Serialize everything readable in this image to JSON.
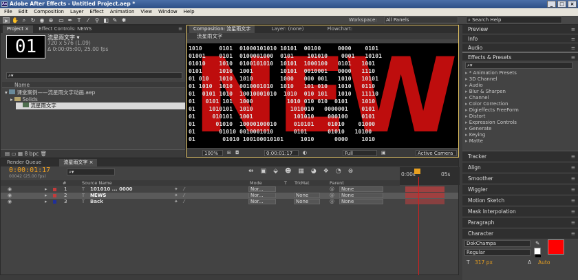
{
  "app": {
    "title": "Adobe After Effects - Untitled Project.aep *",
    "badge": "Ae"
  },
  "window_controls": [
    "_",
    "□",
    "×"
  ],
  "menu": [
    "File",
    "Edit",
    "Composition",
    "Layer",
    "Effect",
    "Animation",
    "View",
    "Window",
    "Help"
  ],
  "toolbar": {
    "workspace_label": "Workspace:",
    "workspace_value": "All Panels",
    "search_help": "Search Help"
  },
  "project_panel": {
    "tabs": [
      "Project ×",
      "Effect Controls: NEWS"
    ],
    "thumb_text": "01",
    "comp_name": "流星雨文字 ▾",
    "comp_dims": "720 x 576 (1.09)",
    "comp_duration": "Δ 0:00:05:00, 25.00 fps",
    "search_placeholder": "⌕▾",
    "column_name": "Name",
    "items": [
      {
        "label": "课堂案例——流星雨文字动画.aep",
        "type": "project"
      },
      {
        "label": "Solids",
        "type": "folder"
      },
      {
        "label": "流星雨文字",
        "type": "comp"
      }
    ],
    "footer_bpc": "8 bpc"
  },
  "comp_panel": {
    "tabs": [
      "Composition: 流星雨文字",
      "Layer: (none)",
      "Flowchart:"
    ],
    "subtab": "流星雨文字",
    "binary_rows": [
      "1010     0101  01000101010 10101  00100     0000    0101",
      "01001    0101  0100001000  0101    101010    0001   10101",
      "01010    1010  0100101010  10101  1000100   0101   1001",
      "0101     1010  1001        10101  0010001   0000   1110",
      "01 010   1010  1010        1000   000 001   1010   10101",
      "01 1010  1010  0010001010  1010   101 010   1010   0110",
      "01  0101 1010  10010001010  1010  010 101   1010   11110",
      "01   0101 101  1000          1010 010 010  0101    1010",
      "01    1010101  1010           1010010   0000001    0101",
      "01     010101  1001            101010    000100    0101",
      "01      01010  10000100010     010101    01010    01000",
      "01       01010 0010001010      0101      01010   10100",
      "01        01010 100100010101     1010      0000    1010"
    ],
    "big_text": "NEWS",
    "zoom": "100%",
    "timecode": "0:00:01:17",
    "resolution": "Full",
    "camera": "Active Camera"
  },
  "timeline": {
    "tabs": [
      "Render Queue",
      "流星雨文字 ×"
    ],
    "current_time": "0:00:01:17",
    "fps_line": "00042 (25.00 fps)",
    "search_placeholder": "⌕▾",
    "columns": {
      "num": "#",
      "source": "Source Name",
      "mode": "Mode",
      "t": "T",
      "trkmat": "TrkMat",
      "parent": "Parent"
    },
    "ruler": {
      "start": "0:00s",
      "end": "05s"
    },
    "layers": [
      {
        "num": "1",
        "name": "101010 ... 0000",
        "mode": "Nor...",
        "trkmat": "",
        "parent": "None",
        "color": "#c33c3c",
        "selected": false
      },
      {
        "num": "2",
        "name": "NEWS",
        "mode": "Nor...",
        "trkmat": "None",
        "parent": "None",
        "color": "#c33c3c",
        "selected": true
      },
      {
        "num": "3",
        "name": "Back",
        "mode": "Nor...",
        "trkmat": "None",
        "parent": "None",
        "color": "#1f2f9a",
        "selected": false
      }
    ]
  },
  "right_panels": {
    "info": "Info",
    "audio": "Audio",
    "preview": "Preview",
    "effects_header": "Effects & Presets",
    "effects_search": "⌕▾",
    "effects": [
      "* Animation Presets",
      "3D Channel",
      "Audio",
      "Blur & Sharpen",
      "Channel",
      "Color Correction",
      "Digieffects FreeForm",
      "Distort",
      "Expression Controls",
      "Generate",
      "Keying",
      "Matte"
    ],
    "collapsed": [
      "Tracker",
      "Align",
      "Smoother",
      "Wiggler",
      "Motion Sketch",
      "Mask Interpolation",
      "Paragraph",
      "Character"
    ],
    "character": {
      "font": "DokChampa",
      "style": "Regular",
      "size": "317 px",
      "leading": "Auto",
      "fill_color": "#ff0000"
    }
  }
}
